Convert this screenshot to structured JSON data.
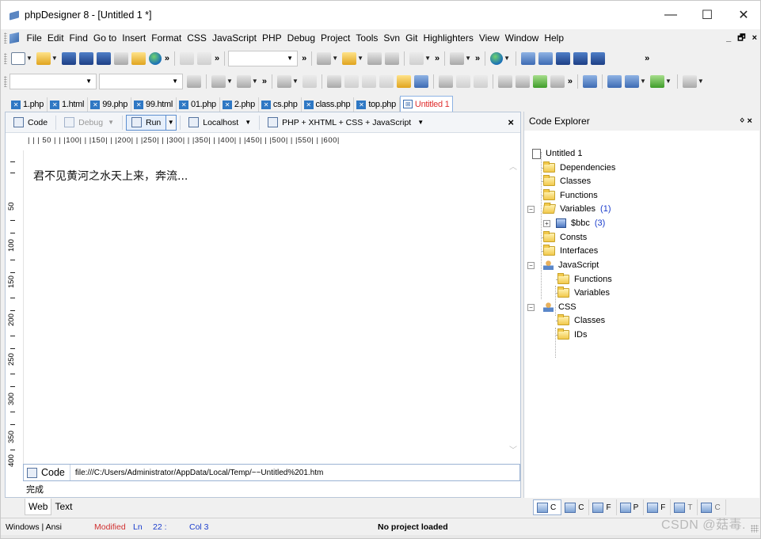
{
  "window": {
    "title": "phpDesigner 8 - [Untitled 1 *]",
    "controls": {
      "minimize": "—",
      "maximize": "☐",
      "close": "✕"
    }
  },
  "menubar": {
    "items": [
      "File",
      "Edit",
      "Find",
      "Go to",
      "Insert",
      "Format",
      "CSS",
      "JavaScript",
      "PHP",
      "Debug",
      "Project",
      "Tools",
      "Svn",
      "Git",
      "Highlighters",
      "View",
      "Window",
      "Help"
    ],
    "mdi_controls": {
      "minimize": "_",
      "restore": "🗗",
      "close": "×"
    }
  },
  "file_tabs": [
    {
      "label": "1.php"
    },
    {
      "label": "1.html"
    },
    {
      "label": "99.php"
    },
    {
      "label": "99.html"
    },
    {
      "label": "01.php"
    },
    {
      "label": "2.php"
    },
    {
      "label": "cs.php"
    },
    {
      "label": "class.php"
    },
    {
      "label": "top.php"
    },
    {
      "label": "Untitled 1"
    }
  ],
  "editor_toolbar": {
    "code": "Code",
    "debug": "Debug",
    "run": "Run",
    "localhost": "Localhost",
    "language": "PHP + XHTML + CSS + JavaScript",
    "close": "×"
  },
  "ruler": {
    "horizontal": "| | | 50 | | |100| | |150| | |200| | |250| | |300| | |350| | |400| | |450| | |500| | |550| | |600|",
    "vertical_labels": [
      "50",
      "100",
      "150",
      "200",
      "250",
      "300",
      "350",
      "400"
    ]
  },
  "editor": {
    "content": "君不见黄河之水天上来，奔流...",
    "status_tab": "Code",
    "path": "file:///C:/Users/Administrator/AppData/Local/Temp/~~Untitled%201.htm",
    "browser_status": "完成"
  },
  "view_tabs": {
    "web": "Web",
    "text": "Text"
  },
  "code_explorer": {
    "title": "Code Explorer",
    "pin": "ᛜ ×",
    "root": "Untitled 1",
    "php_nodes": [
      {
        "label": "Dependencies"
      },
      {
        "label": "Classes"
      },
      {
        "label": "Functions"
      },
      {
        "label": "Variables",
        "count": "(1)"
      },
      {
        "label": "$bbc",
        "count": "(3)"
      },
      {
        "label": "Consts"
      },
      {
        "label": "Interfaces"
      }
    ],
    "javascript": {
      "label": "JavaScript",
      "children": [
        "Functions",
        "Variables"
      ]
    },
    "css": {
      "label": "CSS",
      "children": [
        "Classes",
        "IDs"
      ]
    },
    "bottom_tabs": [
      "C",
      "C",
      "F",
      "P",
      "F",
      "T",
      "C"
    ]
  },
  "statusbar": {
    "encoding": "Windows | Ansi",
    "modified": "Modified",
    "ln_label": "Ln",
    "ln_value": "22 :",
    "col": "Col  3",
    "project": "No project loaded"
  },
  "watermark": "CSDN @菇毒."
}
